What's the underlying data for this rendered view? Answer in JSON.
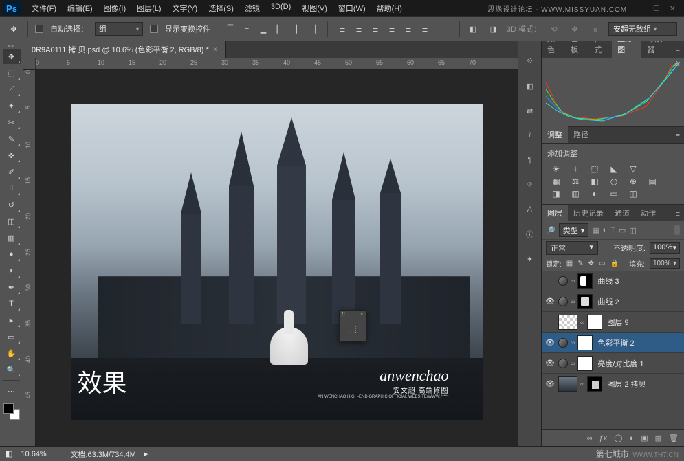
{
  "brand": {
    "watermark_top": "思缘设计论坛 - WWW.MISSYUAN.COM",
    "watermark_bottom": "第七城市",
    "watermark_url": "WWW.TH7.CN"
  },
  "menu": {
    "file": "文件(F)",
    "edit": "编辑(E)",
    "image": "图像(I)",
    "layer": "图层(L)",
    "type": "文字(Y)",
    "select": "选择(S)",
    "filter": "滤镜",
    "threeD": "3D(D)",
    "view": "视图(V)",
    "window": "窗口(W)",
    "help": "帮助(H)"
  },
  "options": {
    "auto_select": "自动选择：",
    "group": "组",
    "show_transform": "显示变换控件",
    "mode3d": "3D 模式：",
    "right_combo": "安超无敌组"
  },
  "doc_tab": {
    "title": "0R9A0111 拷 贝.psd @ 10.6% (色彩平衡 2, RGB/8) *"
  },
  "ruler_h": [
    "0",
    "5",
    "10",
    "15",
    "20",
    "25",
    "30",
    "35",
    "40",
    "45",
    "50",
    "55",
    "60",
    "65",
    "70"
  ],
  "ruler_v": [
    "0",
    "5",
    "10",
    "15",
    "20",
    "25",
    "30",
    "35",
    "40",
    "45"
  ],
  "image_text": {
    "result_label": "效果",
    "script": "anwenchao",
    "cn": "安文超 高端修图",
    "tiny": "AN WENCHAO HIGH-END GRAPHIC OFFICIAL WEBSITE/WWW.*****"
  },
  "panel_tabs": {
    "color": "颜色",
    "swatches": "色板",
    "styles": "样式",
    "histogram": "直方图",
    "navigator": "导航器"
  },
  "adjust_tabs": {
    "adjust": "调整",
    "paths": "路径"
  },
  "adjust": {
    "title": "添加调整"
  },
  "layers_tabs": {
    "layers": "图层",
    "history": "历史记录",
    "channels": "通道",
    "actions": "动作"
  },
  "layers": {
    "filter": "类型",
    "blend": "正常",
    "opacity_label": "不透明度:",
    "opacity": "100%",
    "lock_label": "锁定:",
    "fill_label": "填充:",
    "fill": "100%",
    "items": [
      {
        "name": "曲线 3"
      },
      {
        "name": "曲线 2"
      },
      {
        "name": "图层 9"
      },
      {
        "name": "色彩平衡 2"
      },
      {
        "name": "亮度/对比度 1"
      },
      {
        "name": "图层 2 拷贝"
      }
    ]
  },
  "status": {
    "zoom": "10.64%",
    "doc_label": "文档:",
    "doc_size": "63.3M/734.4M"
  }
}
